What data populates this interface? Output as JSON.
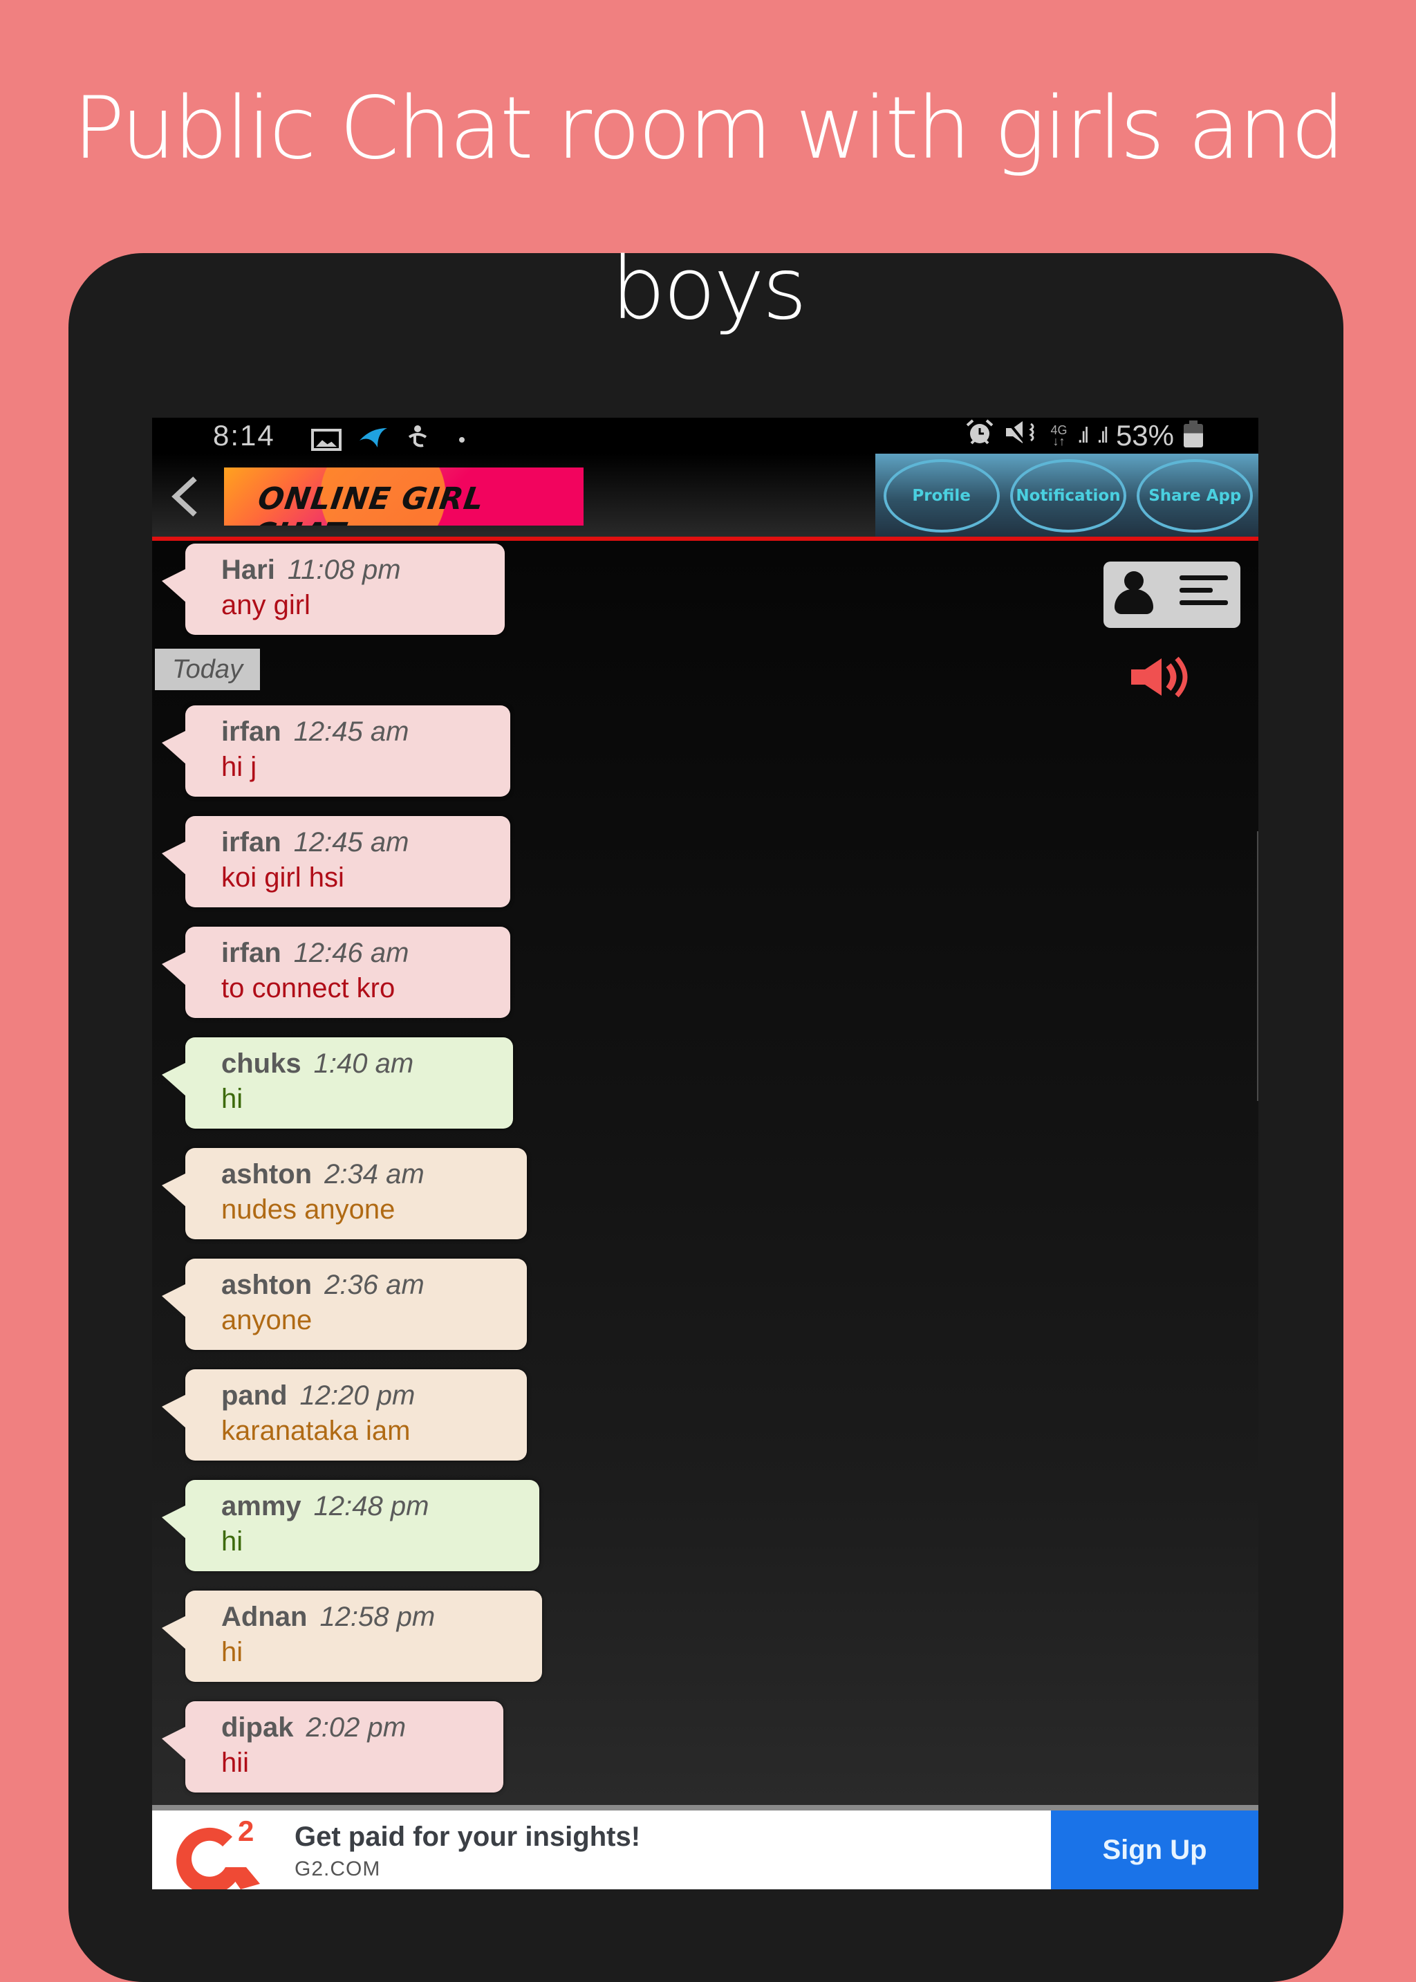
{
  "headline": "Public Chat room with girls and boys",
  "status_bar": {
    "time": "8:14",
    "network": "4G",
    "battery": "53%",
    "left_icons": [
      "image-icon",
      "carrier-icon",
      "accessibility-icon",
      "dot-icon"
    ],
    "right_icons": [
      "alarm-icon",
      "mute-icon",
      "4g-icon",
      "signal-icon",
      "signal-icon",
      "battery-icon"
    ]
  },
  "app_bar": {
    "logo_text": "ONLINE GIRL CHAT",
    "buttons": {
      "profile": "Profile",
      "notification": "Notification",
      "share": "Share App"
    }
  },
  "chat": {
    "date_divider": "Today",
    "messages": [
      {
        "name": "Hari",
        "time": "11:08 pm",
        "text": "any girl",
        "style": "pink"
      },
      {
        "name": "irfan",
        "time": "12:45 am",
        "text": "hi j",
        "style": "pink"
      },
      {
        "name": "irfan",
        "time": "12:45 am",
        "text": "koi girl hsi",
        "style": "pink"
      },
      {
        "name": "irfan",
        "time": "12:46 am",
        "text": "to connect kro",
        "style": "pink"
      },
      {
        "name": "chuks",
        "time": "1:40 am",
        "text": "hi",
        "style": "green"
      },
      {
        "name": "ashton",
        "time": "2:34 am",
        "text": "nudes anyone",
        "style": "beige"
      },
      {
        "name": "ashton",
        "time": "2:36 am",
        "text": "anyone",
        "style": "beige"
      },
      {
        "name": "pand",
        "time": "12:20 pm",
        "text": "karanataka iam",
        "style": "beige"
      },
      {
        "name": "ammy",
        "time": "12:48 pm",
        "text": "hi",
        "style": "green"
      },
      {
        "name": "Adnan",
        "time": "12:58 pm",
        "text": "hi",
        "style": "beige"
      },
      {
        "name": "dipak",
        "time": "2:02 pm",
        "text": "hii",
        "style": "pink"
      }
    ]
  },
  "ad": {
    "title": "Get paid for your insights!",
    "url": "G2.COM",
    "cta": "Sign Up",
    "logo_text": "2"
  },
  "colors": {
    "background": "#f08080",
    "accent_red": "#e01010",
    "speaker_red": "#f05050",
    "cta_blue": "#1a73e8"
  }
}
